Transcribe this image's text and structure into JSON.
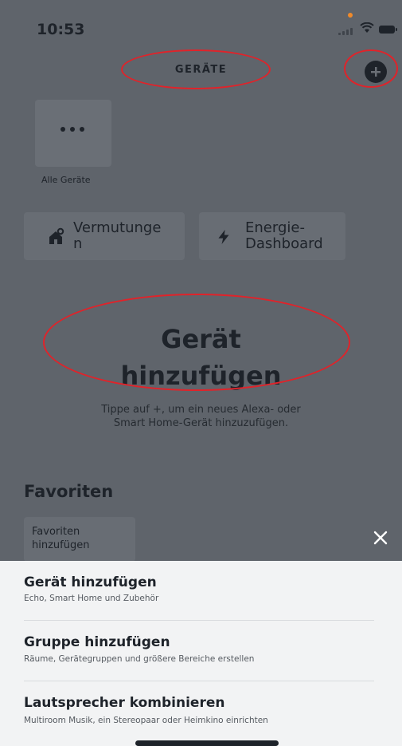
{
  "status_bar": {
    "time": "10:53"
  },
  "header": {
    "title": "GERÄTE",
    "add_button_icon": "plus-circle-icon"
  },
  "all_devices": {
    "label": "Alle Geräte",
    "icon": "more-dots-icon"
  },
  "chips": [
    {
      "label": "Vermutunge\nn",
      "icon": "smart-home-icon"
    },
    {
      "label": "Energie-\nDashboard",
      "icon": "lightning-icon"
    }
  ],
  "empty_state": {
    "title": "Gerät\nhinzufügen",
    "text": "Tippe auf +, um ein neues Alexa- oder Smart Home-Gerät hinzuzufügen."
  },
  "favorites": {
    "heading": "Favoriten",
    "tile_label": "Favoriten\nhinzufügen"
  },
  "sheet": {
    "items": [
      {
        "title": "Gerät hinzufügen",
        "subtitle": "Echo, Smart Home und Zubehör"
      },
      {
        "title": "Gruppe hinzufügen",
        "subtitle": "Räume, Gerätegruppen und größere Bereiche erstellen"
      },
      {
        "title": "Lautsprecher kombinieren",
        "subtitle": "Multiroom Musik, ein Stereopaar oder Heimkino einrichten"
      }
    ]
  },
  "colors": {
    "highlight": "#e0232a",
    "overlay": "#5f646b",
    "sheet": "#f2f3f4",
    "status_dot": "#f08a2a"
  }
}
